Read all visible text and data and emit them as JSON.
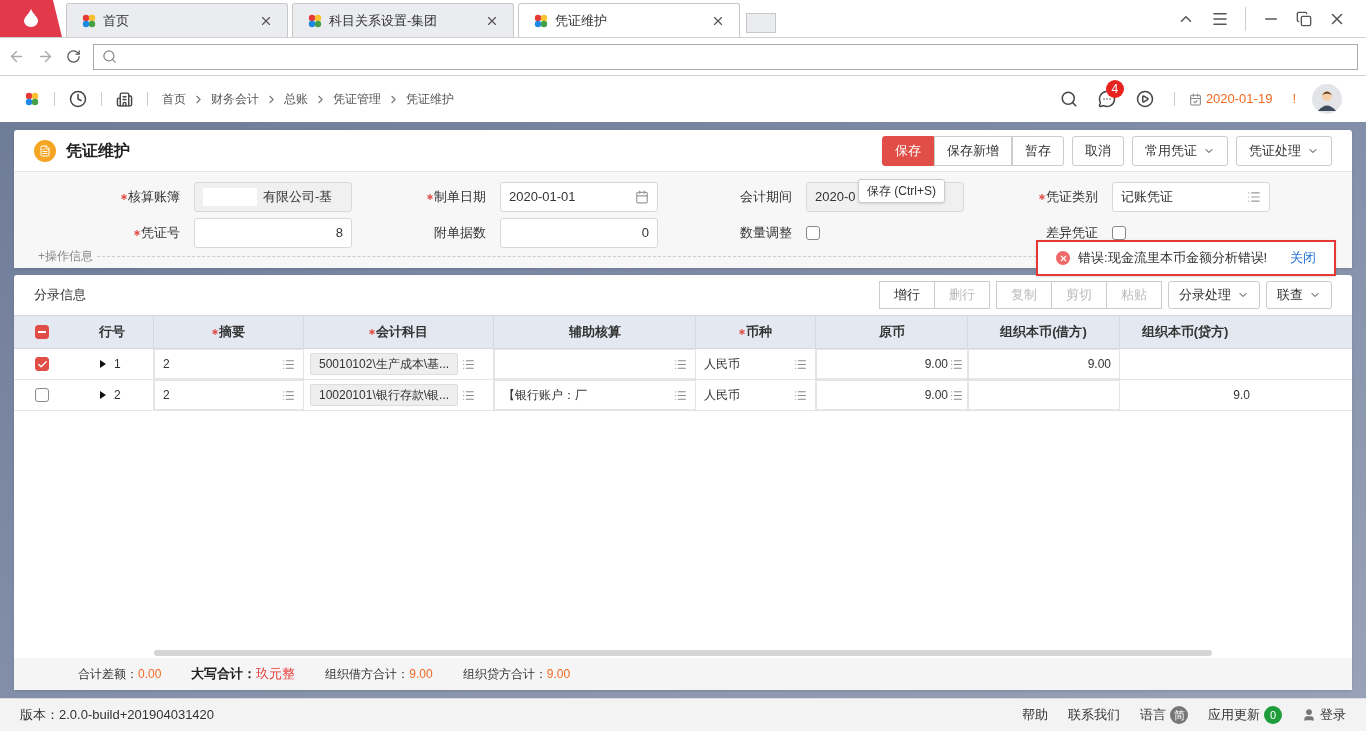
{
  "browser": {
    "tabs": [
      {
        "label": "首页",
        "selected": false
      },
      {
        "label": "科目关系设置-集团",
        "selected": false
      },
      {
        "label": "凭证维护",
        "selected": true
      }
    ]
  },
  "app_header": {
    "breadcrumb": [
      "首页",
      "财务会计",
      "总账",
      "凭证管理",
      "凭证维护"
    ],
    "notification_count": "4",
    "date": "2020-01-19",
    "alert": "!"
  },
  "page": {
    "title": "凭证维护",
    "actions": [
      {
        "label": "保存",
        "kind": "primary"
      },
      {
        "label": "保存新增",
        "kind": "group"
      },
      {
        "label": "暂存",
        "kind": "group"
      },
      {
        "label": "取消",
        "kind": "plain"
      },
      {
        "label": "常用凭证",
        "kind": "dropdown"
      },
      {
        "label": "凭证处理",
        "kind": "dropdown"
      }
    ],
    "tooltip": "保存 (Ctrl+S)"
  },
  "form": {
    "fields": [
      {
        "label": "核算账簿",
        "required": true,
        "kind": "readonly_list",
        "value": "有限公司-基"
      },
      {
        "label": "制单日期",
        "required": true,
        "kind": "date",
        "value": "2020-01-01"
      },
      {
        "label": "会计期间",
        "required": false,
        "kind": "readonly",
        "value": "2020-0"
      },
      {
        "label": "凭证类别",
        "required": true,
        "kind": "list",
        "value": "记账凭证"
      },
      {
        "label": "凭证号",
        "required": true,
        "kind": "number",
        "value": "8"
      },
      {
        "label": "附单据数",
        "required": false,
        "kind": "number",
        "value": "0"
      },
      {
        "label": "数量调整",
        "required": false,
        "kind": "checkbox",
        "checked": false
      },
      {
        "label": "差异凭证",
        "required": false,
        "kind": "checkbox",
        "checked": false
      }
    ],
    "operation_info": "+操作信息"
  },
  "error": {
    "message": "错误:现金流里本币金额分析错误!",
    "close": "关闭"
  },
  "entries": {
    "title": "分录信息",
    "groups": [
      [
        {
          "label": "增行",
          "disabled": false
        },
        {
          "label": "删行",
          "disabled": true
        }
      ],
      [
        {
          "label": "复制",
          "disabled": true
        },
        {
          "label": "剪切",
          "disabled": true
        },
        {
          "label": "粘贴",
          "disabled": true
        }
      ]
    ],
    "dropdowns": [
      "分录处理",
      "联查"
    ],
    "select_all": {
      "indeterminate": true
    },
    "columns": [
      {
        "label": "行号",
        "required": false
      },
      {
        "label": "摘要",
        "required": true
      },
      {
        "label": "会计科目",
        "required": true
      },
      {
        "label": "辅助核算",
        "required": false
      },
      {
        "label": "币种",
        "required": true
      },
      {
        "label": "原币",
        "required": false
      },
      {
        "label": "组织本币(借方)",
        "required": false
      },
      {
        "label": "组织本币(贷方)",
        "required": false
      }
    ],
    "rows": [
      {
        "selected": true,
        "expanded": false,
        "line": "1",
        "summary": "2",
        "account": "50010102\\生产成本\\基...",
        "auxiliary": "",
        "currency": "人民币",
        "amount": "9.00",
        "debit": "9.00",
        "credit": ""
      },
      {
        "selected": false,
        "expanded": false,
        "line": "2",
        "summary": "2",
        "account": "10020101\\银行存款\\银...",
        "auxiliary": "【银行账户：厂",
        "currency": "人民币",
        "amount": "9.00",
        "debit": "",
        "credit": "9.0"
      }
    ],
    "totals": [
      {
        "label": "合计差额：",
        "value": "0.00",
        "kind": "plain"
      },
      {
        "label": "大写合计：",
        "value": "玖元整",
        "kind": "emphasis"
      },
      {
        "label": "组织借方合计：",
        "value": "9.00",
        "kind": "plain"
      },
      {
        "label": "组织贷方合计：",
        "value": "9.00",
        "kind": "plain"
      }
    ]
  },
  "status_bar": {
    "version": "版本：2.0.0-build+201904031420",
    "links": [
      {
        "label": "帮助",
        "kind": "plain"
      },
      {
        "label": "联系我们",
        "kind": "plain"
      },
      {
        "label": "语言",
        "badge": "简",
        "kind": "grey"
      },
      {
        "label": "应用更新",
        "badge": "0",
        "kind": "green"
      },
      {
        "label": "登录",
        "kind": "user"
      }
    ]
  }
}
